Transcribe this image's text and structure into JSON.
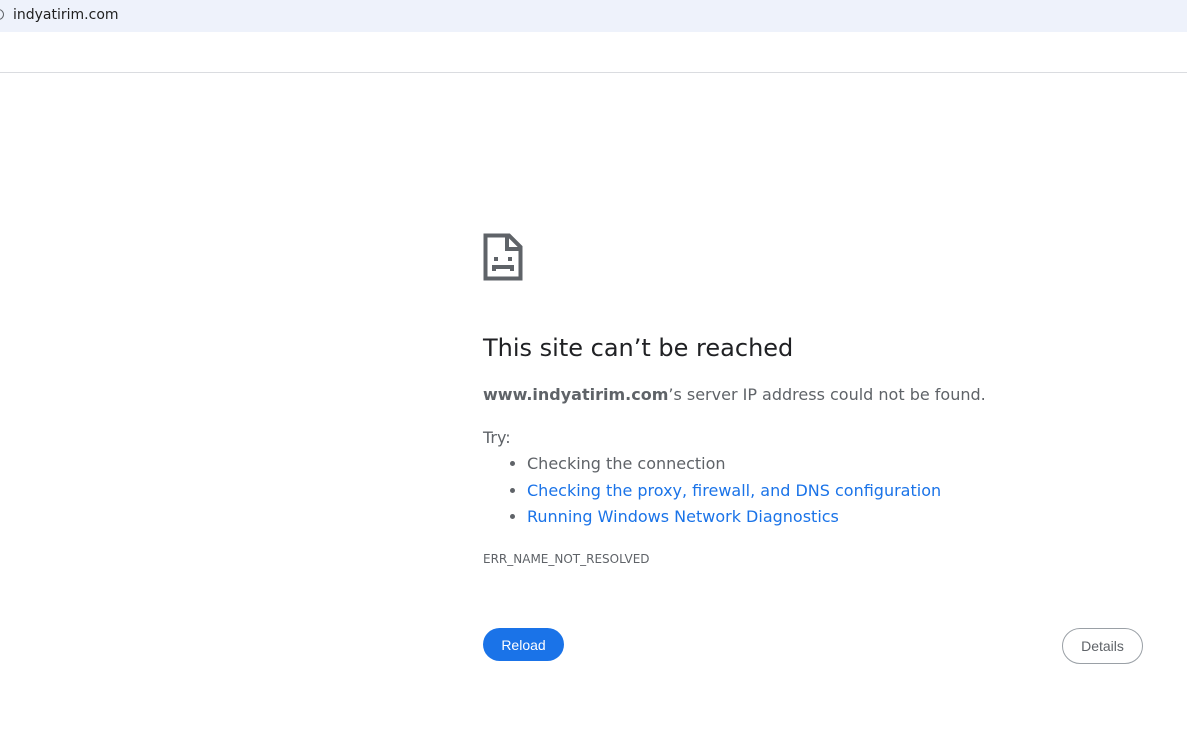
{
  "address_bar": {
    "url": "indyatirim.com",
    "site_icon": "info-circle-icon"
  },
  "error_page": {
    "icon": "sad-page-icon",
    "title": "This site can’t be reached",
    "host": "www.indyatirim.com",
    "description_suffix": "’s server IP address could not be found.",
    "try_label": "Try:",
    "suggestions": [
      "Checking the connection",
      "Checking the proxy, firewall, and DNS configuration",
      "Running Windows Network Diagnostics"
    ],
    "error_code": "ERR_NAME_NOT_RESOLVED",
    "reload_label": "Reload",
    "details_label": "Details"
  },
  "colors": {
    "link": "#1a73e8",
    "primary_button": "#1a73e8",
    "secondary_text": "#5f6368",
    "address_bar_bg": "#eef2fb"
  }
}
